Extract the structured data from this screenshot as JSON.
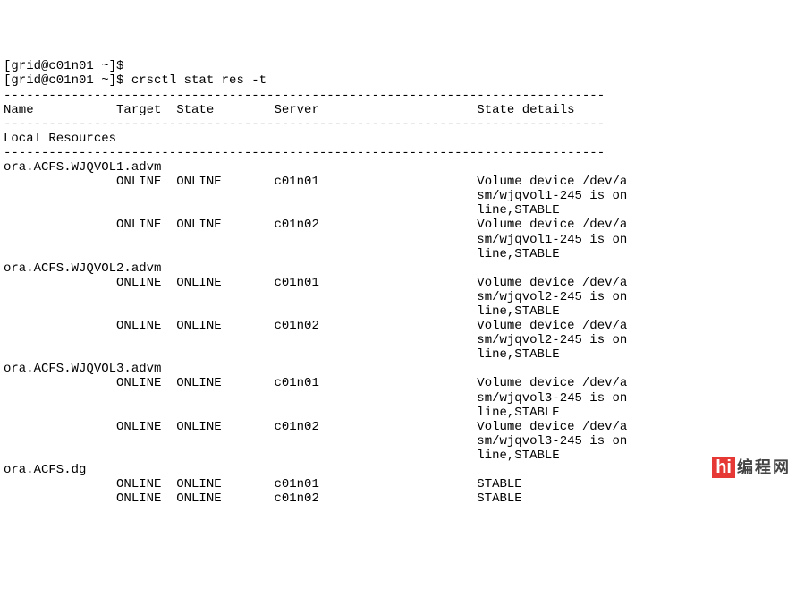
{
  "prompt_prev": "[grid@c01n01 ~]$ ",
  "prompt": "[grid@c01n01 ~]$ ",
  "command": "crsctl stat res -t",
  "dash80": "--------------------------------------------------------------------------------",
  "headers": {
    "name": "Name",
    "target": "Target",
    "state": "State",
    "server": "Server",
    "details": "State details"
  },
  "section_local": "Local Resources",
  "resources": [
    {
      "name": "ora.ACFS.WJQVOL1.advm",
      "rows": [
        {
          "target": "ONLINE",
          "state": "ONLINE",
          "server": "c01n01",
          "d1": "Volume device /dev/a",
          "d2": "sm/wjqvol1-245 is on",
          "d3": "line,STABLE"
        },
        {
          "target": "ONLINE",
          "state": "ONLINE",
          "server": "c01n02",
          "d1": "Volume device /dev/a",
          "d2": "sm/wjqvol1-245 is on",
          "d3": "line,STABLE"
        }
      ]
    },
    {
      "name": "ora.ACFS.WJQVOL2.advm",
      "rows": [
        {
          "target": "ONLINE",
          "state": "ONLINE",
          "server": "c01n01",
          "d1": "Volume device /dev/a",
          "d2": "sm/wjqvol2-245 is on",
          "d3": "line,STABLE"
        },
        {
          "target": "ONLINE",
          "state": "ONLINE",
          "server": "c01n02",
          "d1": "Volume device /dev/a",
          "d2": "sm/wjqvol2-245 is on",
          "d3": "line,STABLE"
        }
      ]
    },
    {
      "name": "ora.ACFS.WJQVOL3.advm",
      "rows": [
        {
          "target": "ONLINE",
          "state": "ONLINE",
          "server": "c01n01",
          "d1": "Volume device /dev/a",
          "d2": "sm/wjqvol3-245 is on",
          "d3": "line,STABLE"
        },
        {
          "target": "ONLINE",
          "state": "ONLINE",
          "server": "c01n02",
          "d1": "Volume device /dev/a",
          "d2": "sm/wjqvol3-245 is on",
          "d3": "line,STABLE"
        }
      ]
    },
    {
      "name": "ora.ACFS.dg",
      "rows": [
        {
          "target": "ONLINE",
          "state": "ONLINE",
          "server": "c01n01",
          "d1": "STABLE",
          "d2": "",
          "d3": ""
        },
        {
          "target": "ONLINE",
          "state": "ONLINE",
          "server": "c01n02",
          "d1": "STABLE",
          "d2": "",
          "d3": ""
        }
      ]
    }
  ],
  "logo": {
    "mark": "hi",
    "text": "编程网"
  }
}
